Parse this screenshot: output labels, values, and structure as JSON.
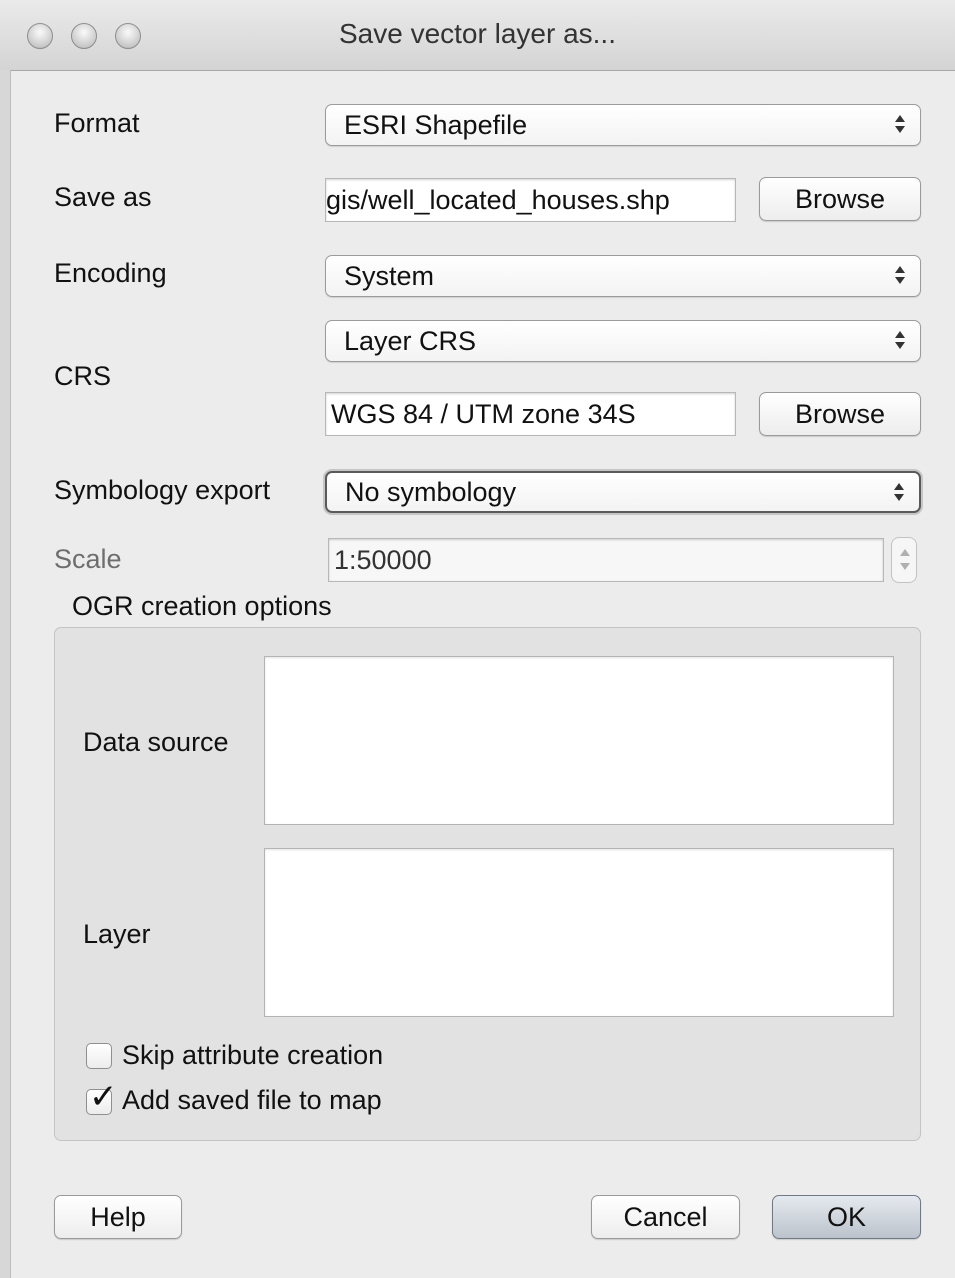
{
  "window": {
    "title": "Save vector layer as...",
    "controls": [
      "close-button",
      "minimize-button",
      "zoom-button"
    ]
  },
  "form": {
    "format": {
      "label": "Format",
      "value": "ESRI Shapefile"
    },
    "save_as": {
      "label": "Save as",
      "value": "gis/well_located_houses.shp",
      "browse_label": "Browse"
    },
    "encoding": {
      "label": "Encoding",
      "value": "System"
    },
    "crs": {
      "label": "CRS",
      "mode_value": "Layer CRS",
      "crs_value": "WGS 84 / UTM zone 34S",
      "browse_label": "Browse"
    },
    "symbology": {
      "label": "Symbology export",
      "value": "No symbology"
    },
    "scale": {
      "label": "Scale",
      "value": "1:50000",
      "enabled": false
    }
  },
  "ogr": {
    "title": "OGR creation options",
    "data_source_label": "Data source",
    "data_source_value": "",
    "layer_label": "Layer",
    "layer_value": "",
    "skip_attribute": {
      "label": "Skip attribute creation",
      "checked": false
    },
    "add_to_map": {
      "label": "Add saved file to map",
      "checked": true
    }
  },
  "buttons": {
    "help": "Help",
    "cancel": "Cancel",
    "ok": "OK"
  }
}
